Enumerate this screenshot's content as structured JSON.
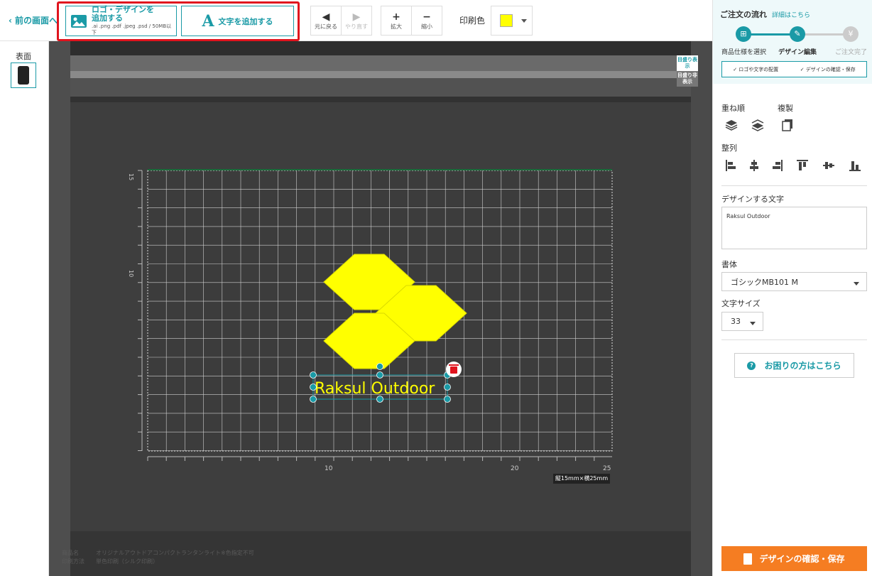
{
  "toolbar": {
    "back_label": "前の画面へ",
    "add_logo_title": "ロゴ・デザインを追加する",
    "add_logo_formats": ".ai .png .pdf .jpeg .psd / 50MB以下",
    "add_text_label": "文字を追加する",
    "undo_label": "元に戻る",
    "redo_label": "やり直す",
    "zoom_in_label": "拡大",
    "zoom_out_label": "縮小",
    "print_color_label": "印刷色",
    "print_color": "#ffff00"
  },
  "side": {
    "face_label": "表面"
  },
  "canvas": {
    "grid_toggle_on": "目盛り表示",
    "grid_toggle_off": "目盛り非表示",
    "ruler_y_labels": [
      "15",
      "10"
    ],
    "ruler_x_labels": [
      "10",
      "20",
      "25"
    ],
    "size_badge": "縦15mm×横25mm",
    "design_text": "Raksul Outdoor",
    "design_color": "#ffff00",
    "accent": "#1a9aa6",
    "footer": {
      "product_key": "商品名",
      "product_value": "オリジナルアウトドアコンパクトランタンライト※色指定不可",
      "method_key": "印刷方法",
      "method_value": "単色印刷（シルク印刷）"
    }
  },
  "panel": {
    "flow_title": "ご注文の流れ",
    "flow_link": "詳細はこちら",
    "steps": [
      "商品仕様を選択",
      "デザイン編集",
      "ご注文完了"
    ],
    "step_icons": [
      "gift-icon",
      "pencil-icon",
      "yen-icon"
    ],
    "chips": [
      "✓ ロゴや文字の配置",
      "✓ デザインの確認・保存"
    ],
    "order_label": "重ね順",
    "duplicate_label": "複製",
    "align_label": "整列",
    "text_label": "デザインする文字",
    "text_value": "Raksul Outdoor",
    "font_label": "書体",
    "font_value": "ゴシックMB101 M",
    "size_label": "文字サイズ",
    "size_value": "33",
    "help_label": "お困りの方はこちら",
    "save_label": "デザインの確認・保存",
    "save_color": "#f57d22"
  }
}
